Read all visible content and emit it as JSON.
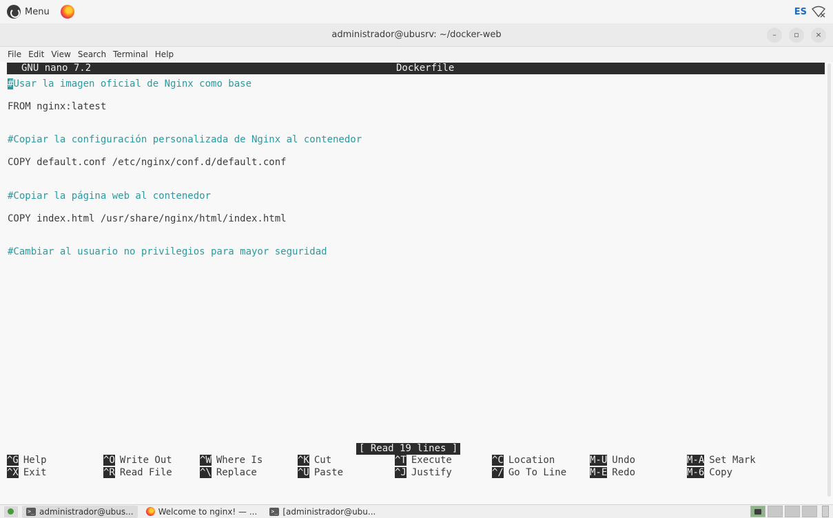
{
  "top_panel": {
    "menu_label": "Menu",
    "lang": "ES",
    "icons": [
      "mint-menu-icon",
      "firefox-icon",
      "network-icon"
    ]
  },
  "window": {
    "title": "administrador@ubusrv: ~/docker-web",
    "controls": {
      "minimize": "–",
      "maximize": "▫",
      "close": "×"
    }
  },
  "menubar": [
    "File",
    "Edit",
    "View",
    "Search",
    "Terminal",
    "Help"
  ],
  "nano": {
    "version": "GNU nano 7.2",
    "filename": "Dockerfile",
    "lines": [
      {
        "type": "comment",
        "text": "#Usar la imagen oficial de Nginx como base",
        "cursor": true
      },
      {
        "type": "code",
        "text": "FROM nginx:latest"
      },
      {
        "type": "blank",
        "text": ""
      },
      {
        "type": "comment",
        "text": "#Copiar la configuración personalizada de Nginx al contenedor"
      },
      {
        "type": "code",
        "text": "COPY default.conf /etc/nginx/conf.d/default.conf"
      },
      {
        "type": "blank",
        "text": ""
      },
      {
        "type": "comment",
        "text": "#Copiar la página web al contenedor"
      },
      {
        "type": "code",
        "text": "COPY index.html /usr/share/nginx/html/index.html"
      },
      {
        "type": "blank",
        "text": ""
      },
      {
        "type": "comment",
        "text": "#Cambiar al usuario no privilegios para mayor seguridad"
      }
    ],
    "status": "[ Read 19 lines ]",
    "shortcuts": [
      {
        "key": "^G",
        "label": "Help"
      },
      {
        "key": "^O",
        "label": "Write Out"
      },
      {
        "key": "^W",
        "label": "Where Is"
      },
      {
        "key": "^K",
        "label": "Cut"
      },
      {
        "key": "^T",
        "label": "Execute"
      },
      {
        "key": "^C",
        "label": "Location"
      },
      {
        "key": "M-U",
        "label": "Undo"
      },
      {
        "key": "M-A",
        "label": "Set Mark"
      },
      {
        "key": "^X",
        "label": "Exit"
      },
      {
        "key": "^R",
        "label": "Read File"
      },
      {
        "key": "^\\",
        "label": "Replace"
      },
      {
        "key": "^U",
        "label": "Paste"
      },
      {
        "key": "^J",
        "label": "Justify"
      },
      {
        "key": "^/",
        "label": "Go To Line"
      },
      {
        "key": "M-E",
        "label": "Redo"
      },
      {
        "key": "M-6",
        "label": "Copy"
      }
    ]
  },
  "taskbar": {
    "items": [
      {
        "icon": "terminal-icon",
        "label": "administrador@ubus...",
        "active": true
      },
      {
        "icon": "firefox-icon",
        "label": "Welcome to nginx! — ...",
        "active": false
      },
      {
        "icon": "terminal-icon",
        "label": "[administrador@ubu...",
        "active": false
      }
    ]
  },
  "colors": {
    "comment": "#2a9aa0",
    "code": "#3c3c3c",
    "nano_bar_bg": "#2c2c2c",
    "terminal_bg": "#f8f8f8"
  }
}
